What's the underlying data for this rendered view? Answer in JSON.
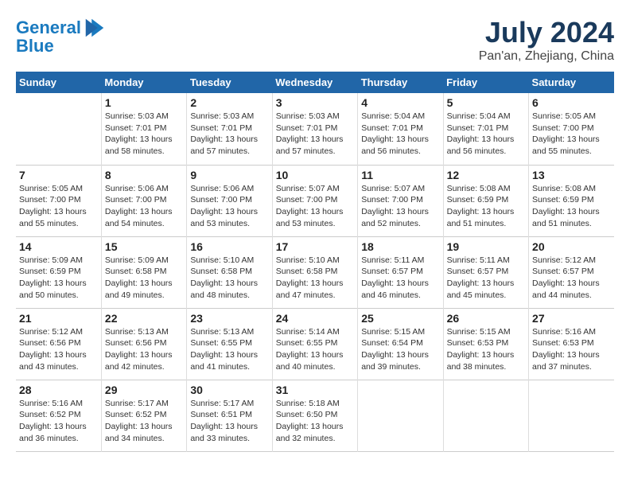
{
  "header": {
    "logo_line1": "General",
    "logo_line2": "Blue",
    "month": "July 2024",
    "location": "Pan'an, Zhejiang, China"
  },
  "columns": [
    "Sunday",
    "Monday",
    "Tuesday",
    "Wednesday",
    "Thursday",
    "Friday",
    "Saturday"
  ],
  "weeks": [
    [
      {
        "day": "",
        "info": ""
      },
      {
        "day": "1",
        "info": "Sunrise: 5:03 AM\nSunset: 7:01 PM\nDaylight: 13 hours\nand 58 minutes."
      },
      {
        "day": "2",
        "info": "Sunrise: 5:03 AM\nSunset: 7:01 PM\nDaylight: 13 hours\nand 57 minutes."
      },
      {
        "day": "3",
        "info": "Sunrise: 5:03 AM\nSunset: 7:01 PM\nDaylight: 13 hours\nand 57 minutes."
      },
      {
        "day": "4",
        "info": "Sunrise: 5:04 AM\nSunset: 7:01 PM\nDaylight: 13 hours\nand 56 minutes."
      },
      {
        "day": "5",
        "info": "Sunrise: 5:04 AM\nSunset: 7:01 PM\nDaylight: 13 hours\nand 56 minutes."
      },
      {
        "day": "6",
        "info": "Sunrise: 5:05 AM\nSunset: 7:00 PM\nDaylight: 13 hours\nand 55 minutes."
      }
    ],
    [
      {
        "day": "7",
        "info": "Sunrise: 5:05 AM\nSunset: 7:00 PM\nDaylight: 13 hours\nand 55 minutes."
      },
      {
        "day": "8",
        "info": "Sunrise: 5:06 AM\nSunset: 7:00 PM\nDaylight: 13 hours\nand 54 minutes."
      },
      {
        "day": "9",
        "info": "Sunrise: 5:06 AM\nSunset: 7:00 PM\nDaylight: 13 hours\nand 53 minutes."
      },
      {
        "day": "10",
        "info": "Sunrise: 5:07 AM\nSunset: 7:00 PM\nDaylight: 13 hours\nand 53 minutes."
      },
      {
        "day": "11",
        "info": "Sunrise: 5:07 AM\nSunset: 7:00 PM\nDaylight: 13 hours\nand 52 minutes."
      },
      {
        "day": "12",
        "info": "Sunrise: 5:08 AM\nSunset: 6:59 PM\nDaylight: 13 hours\nand 51 minutes."
      },
      {
        "day": "13",
        "info": "Sunrise: 5:08 AM\nSunset: 6:59 PM\nDaylight: 13 hours\nand 51 minutes."
      }
    ],
    [
      {
        "day": "14",
        "info": "Sunrise: 5:09 AM\nSunset: 6:59 PM\nDaylight: 13 hours\nand 50 minutes."
      },
      {
        "day": "15",
        "info": "Sunrise: 5:09 AM\nSunset: 6:58 PM\nDaylight: 13 hours\nand 49 minutes."
      },
      {
        "day": "16",
        "info": "Sunrise: 5:10 AM\nSunset: 6:58 PM\nDaylight: 13 hours\nand 48 minutes."
      },
      {
        "day": "17",
        "info": "Sunrise: 5:10 AM\nSunset: 6:58 PM\nDaylight: 13 hours\nand 47 minutes."
      },
      {
        "day": "18",
        "info": "Sunrise: 5:11 AM\nSunset: 6:57 PM\nDaylight: 13 hours\nand 46 minutes."
      },
      {
        "day": "19",
        "info": "Sunrise: 5:11 AM\nSunset: 6:57 PM\nDaylight: 13 hours\nand 45 minutes."
      },
      {
        "day": "20",
        "info": "Sunrise: 5:12 AM\nSunset: 6:57 PM\nDaylight: 13 hours\nand 44 minutes."
      }
    ],
    [
      {
        "day": "21",
        "info": "Sunrise: 5:12 AM\nSunset: 6:56 PM\nDaylight: 13 hours\nand 43 minutes."
      },
      {
        "day": "22",
        "info": "Sunrise: 5:13 AM\nSunset: 6:56 PM\nDaylight: 13 hours\nand 42 minutes."
      },
      {
        "day": "23",
        "info": "Sunrise: 5:13 AM\nSunset: 6:55 PM\nDaylight: 13 hours\nand 41 minutes."
      },
      {
        "day": "24",
        "info": "Sunrise: 5:14 AM\nSunset: 6:55 PM\nDaylight: 13 hours\nand 40 minutes."
      },
      {
        "day": "25",
        "info": "Sunrise: 5:15 AM\nSunset: 6:54 PM\nDaylight: 13 hours\nand 39 minutes."
      },
      {
        "day": "26",
        "info": "Sunrise: 5:15 AM\nSunset: 6:53 PM\nDaylight: 13 hours\nand 38 minutes."
      },
      {
        "day": "27",
        "info": "Sunrise: 5:16 AM\nSunset: 6:53 PM\nDaylight: 13 hours\nand 37 minutes."
      }
    ],
    [
      {
        "day": "28",
        "info": "Sunrise: 5:16 AM\nSunset: 6:52 PM\nDaylight: 13 hours\nand 36 minutes."
      },
      {
        "day": "29",
        "info": "Sunrise: 5:17 AM\nSunset: 6:52 PM\nDaylight: 13 hours\nand 34 minutes."
      },
      {
        "day": "30",
        "info": "Sunrise: 5:17 AM\nSunset: 6:51 PM\nDaylight: 13 hours\nand 33 minutes."
      },
      {
        "day": "31",
        "info": "Sunrise: 5:18 AM\nSunset: 6:50 PM\nDaylight: 13 hours\nand 32 minutes."
      },
      {
        "day": "",
        "info": ""
      },
      {
        "day": "",
        "info": ""
      },
      {
        "day": "",
        "info": ""
      }
    ]
  ]
}
